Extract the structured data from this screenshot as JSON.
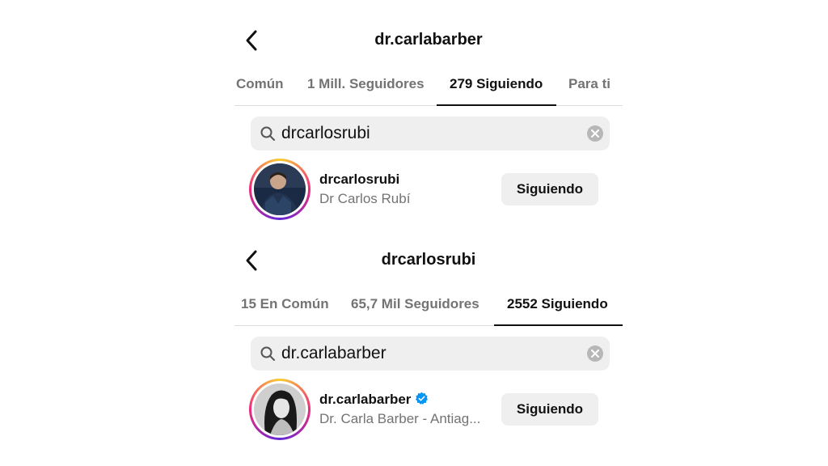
{
  "panels": [
    {
      "header": {
        "title": "dr.carlabarber"
      },
      "tabs": [
        {
          "label": "Común"
        },
        {
          "label": "1 Mill. Seguidores"
        },
        {
          "label": "279 Siguiendo"
        },
        {
          "label": "Para ti"
        }
      ],
      "active_tab": "279 Siguiendo",
      "search": {
        "query": "drcarlosrubi"
      },
      "result": {
        "username": "drcarlosrubi",
        "full_name": "Dr Carlos Rubí",
        "verified": false,
        "button_label": "Siguiendo"
      }
    },
    {
      "header": {
        "title": "drcarlosrubi"
      },
      "tabs": [
        {
          "label": "15 En Común"
        },
        {
          "label": "65,7 Mil Seguidores"
        },
        {
          "label": "2552 Siguiendo"
        }
      ],
      "active_tab": "2552 Siguiendo",
      "search": {
        "query": "dr.carlabarber"
      },
      "result": {
        "username": "dr.carlabarber",
        "full_name": "Dr. Carla Barber - Antiag...",
        "verified": true,
        "button_label": "Siguiendo"
      }
    }
  ],
  "colors": {
    "story_ring": [
      "#f9ce34",
      "#ee2a7b",
      "#6228d7"
    ],
    "verified_badge": "#0095f6",
    "secondary_text": "#737373",
    "button_bg": "#efefef"
  }
}
